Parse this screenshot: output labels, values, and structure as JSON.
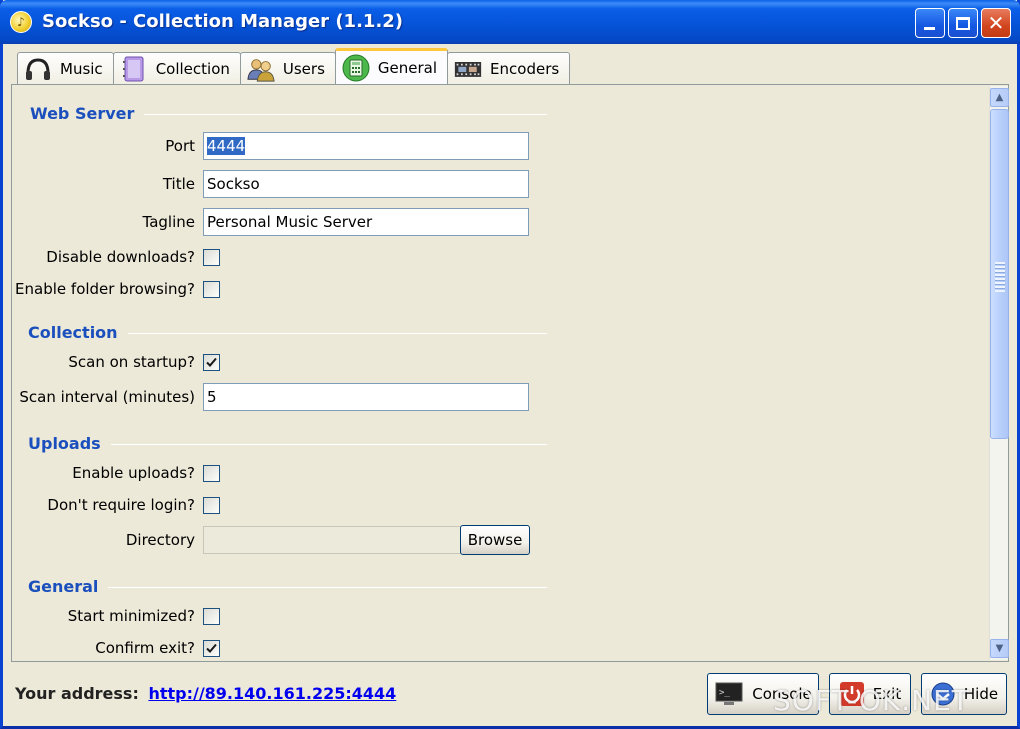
{
  "window": {
    "title": "Sockso - Collection Manager (1.1.2)"
  },
  "tabs": [
    {
      "label": "Music",
      "icon": "headphones-icon"
    },
    {
      "label": "Collection",
      "icon": "notebook-icon"
    },
    {
      "label": "Users",
      "icon": "users-icon"
    },
    {
      "label": "General",
      "icon": "calculator-icon",
      "active": true
    },
    {
      "label": "Encoders",
      "icon": "film-icon"
    }
  ],
  "sections": {
    "web_server": {
      "title": "Web Server",
      "port_label": "Port",
      "port_value": "4444",
      "title_label": "Title",
      "title_value": "Sockso",
      "tagline_label": "Tagline",
      "tagline_value": "Personal Music Server",
      "disable_downloads_label": "Disable downloads?",
      "disable_downloads": false,
      "folder_browsing_label": "Enable folder browsing?",
      "folder_browsing": false
    },
    "collection": {
      "title": "Collection",
      "scan_startup_label": "Scan on startup?",
      "scan_startup": true,
      "scan_interval_label": "Scan interval (minutes)",
      "scan_interval_value": "5"
    },
    "uploads": {
      "title": "Uploads",
      "enable_uploads_label": "Enable uploads?",
      "enable_uploads": false,
      "no_login_label": "Don't require login?",
      "no_login": false,
      "directory_label": "Directory",
      "directory_value": "",
      "browse_label": "Browse"
    },
    "general": {
      "title": "General",
      "start_minimized_label": "Start minimized?",
      "start_minimized": false,
      "confirm_exit_label": "Confirm exit?",
      "confirm_exit": true
    }
  },
  "footer": {
    "address_label": "Your address:",
    "address_url": "http://89.140.161.225:4444",
    "console_label": "Console",
    "exit_label": "Exit",
    "hide_label": "Hide"
  },
  "watermark": "SOFT-OK.NET",
  "colors": {
    "title_bar": "#0552d6",
    "section_heading": "#1a4fbd",
    "link": "#0000ee",
    "selection": "#316ac5"
  }
}
